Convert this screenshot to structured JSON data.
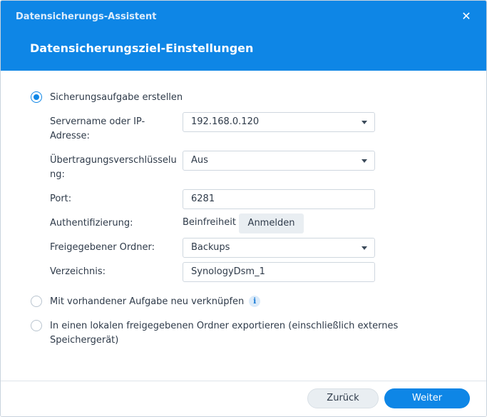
{
  "window": {
    "title": "Datensicherungs-Assistent",
    "close_icon": "close-icon"
  },
  "step": {
    "title": "Datensicherungsziel-Einstellungen"
  },
  "options": [
    {
      "label": "Sicherungsaufgabe erstellen",
      "selected": true
    },
    {
      "label": "Mit vorhandener Aufgabe neu verknüpfen",
      "selected": false,
      "info_icon": "i"
    },
    {
      "label": "In einen lokalen freigegebenen Ordner exportieren (einschließlich externes Speichergerät)",
      "selected": false
    }
  ],
  "form": {
    "server": {
      "label": "Servername oder IP-Adresse:",
      "value": "192.168.0.120"
    },
    "encryption": {
      "label": "Übertragungsverschlüsselung:",
      "value": "Aus"
    },
    "port": {
      "label": "Port:",
      "value": "6281"
    },
    "auth": {
      "label": "Authentifizierung:",
      "value": "Beinfreiheit",
      "button": "Anmelden"
    },
    "shared_folder": {
      "label": "Freigegebener Ordner:",
      "value": "Backups"
    },
    "directory": {
      "label": "Verzeichnis:",
      "value": "SynologyDsm_1"
    }
  },
  "footer": {
    "back": "Zurück",
    "next": "Weiter"
  },
  "colors": {
    "accent": "#0e86e6",
    "header": "#0e86e6"
  }
}
